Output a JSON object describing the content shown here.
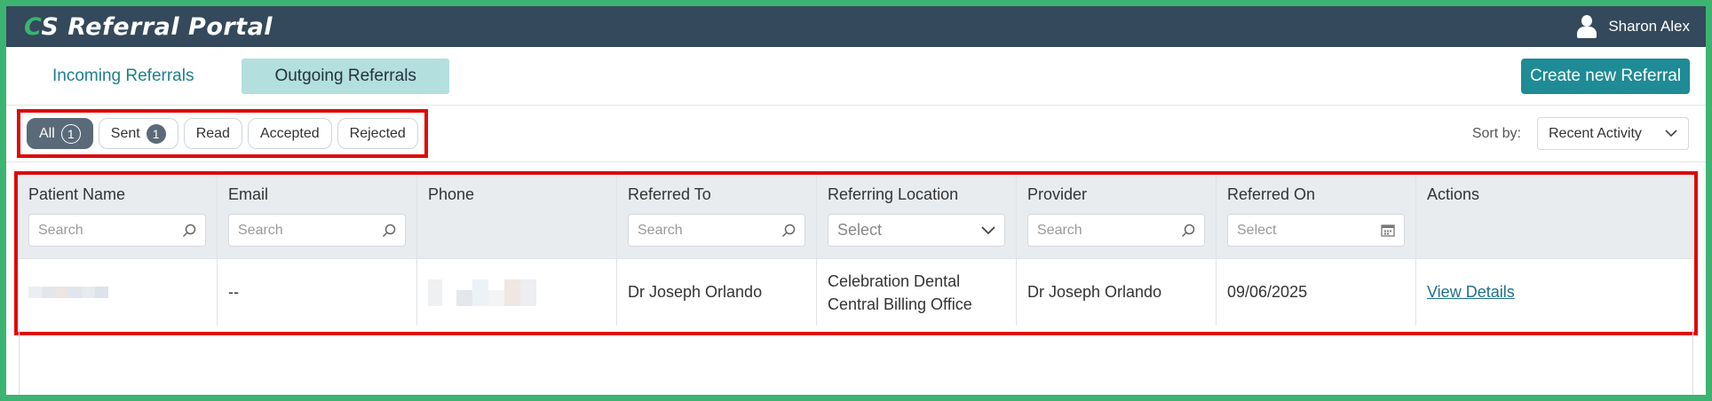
{
  "header": {
    "brand_c": "C",
    "brand_rest": "S Referral Portal",
    "user_name": "Sharon Alex"
  },
  "tabs": [
    {
      "label": "Incoming Referrals",
      "active": false
    },
    {
      "label": "Outgoing Referrals",
      "active": true
    }
  ],
  "create_button": "Create new Referral",
  "filters": [
    {
      "label": "All",
      "count": "1",
      "active": true
    },
    {
      "label": "Sent",
      "count": "1",
      "active": false
    },
    {
      "label": "Read",
      "count": null,
      "active": false
    },
    {
      "label": "Accepted",
      "count": null,
      "active": false
    },
    {
      "label": "Rejected",
      "count": null,
      "active": false
    }
  ],
  "sort": {
    "label": "Sort by:",
    "value": "Recent Activity"
  },
  "table": {
    "columns": [
      {
        "label": "Patient Name",
        "filter": "search",
        "placeholder": "Search"
      },
      {
        "label": "Email",
        "filter": "search",
        "placeholder": "Search"
      },
      {
        "label": "Phone",
        "filter": "none",
        "placeholder": ""
      },
      {
        "label": "Referred To",
        "filter": "search",
        "placeholder": "Search"
      },
      {
        "label": "Referring Location",
        "filter": "select",
        "placeholder": "Select"
      },
      {
        "label": "Provider",
        "filter": "search",
        "placeholder": "Search"
      },
      {
        "label": "Referred On",
        "filter": "date",
        "placeholder": "Select"
      },
      {
        "label": "Actions",
        "filter": "none",
        "placeholder": ""
      }
    ],
    "rows": [
      {
        "patient_name": "",
        "email": "--",
        "phone": "",
        "referred_to": "Dr Joseph Orlando",
        "referring_location_line1": "Celebration Dental",
        "referring_location_line2": "Central Billing Office",
        "provider": "Dr Joseph Orlando",
        "referred_on": "09/06/2025",
        "action": "View Details"
      }
    ]
  },
  "colors": {
    "header_bg": "#34495b",
    "accent": "#1e8b95",
    "active_tab_bg": "#b3dfde",
    "highlight_border": "#dd0a0a",
    "frame_border": "#3cb371"
  },
  "icons": {
    "user": "user-icon",
    "search": "search-icon",
    "chevron": "chevron-down-icon",
    "calendar": "calendar-icon"
  }
}
